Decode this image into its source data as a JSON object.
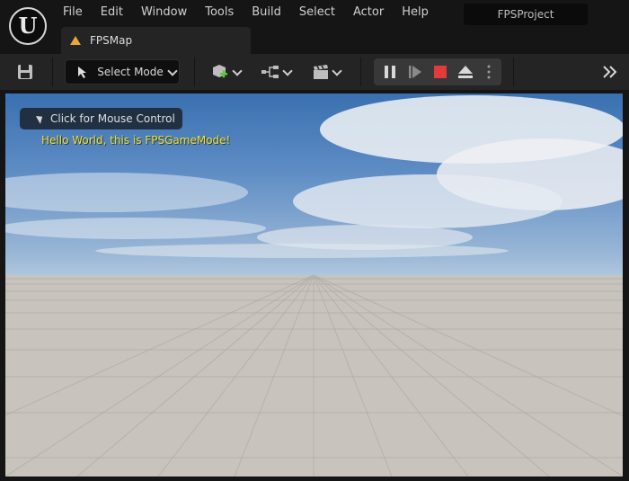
{
  "app": {
    "logo_letter": "U",
    "project_name": "FPSProject"
  },
  "menu": [
    "File",
    "Edit",
    "Window",
    "Tools",
    "Build",
    "Select",
    "Actor",
    "Help"
  ],
  "tab": {
    "label": "FPSMap"
  },
  "toolbar": {
    "mode_label": "Select Mode"
  },
  "viewport": {
    "mouse_control_label": "Click for Mouse Control",
    "message": "Hello World, this is FPSGameMode!"
  },
  "colors": {
    "accent_blue": "#2b7bd6",
    "stop_red": "#e33b3b",
    "map_icon": "#e8a53a",
    "message_yellow": "#e8e23a"
  }
}
